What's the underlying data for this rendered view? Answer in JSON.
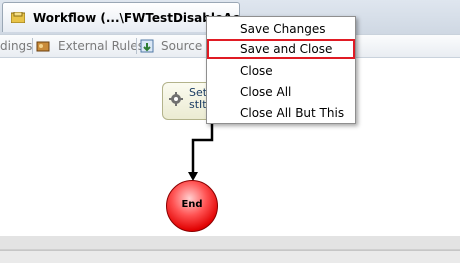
{
  "tab": {
    "title": "Workflow (...\\FWTestDisableAcco"
  },
  "toolbar": {
    "items": [
      {
        "label": "dings"
      },
      {
        "label": "External Rules"
      },
      {
        "label": "Source C"
      }
    ]
  },
  "activity": {
    "line1": "SetE",
    "line2": "stIte"
  },
  "end_node": {
    "label": "End"
  },
  "context_menu": {
    "items": [
      {
        "label": "Save Changes"
      },
      {
        "label": "Save and Close",
        "highlighted": true
      },
      {
        "label": "Close"
      },
      {
        "label": "Close All"
      },
      {
        "label": "Close All But This"
      }
    ]
  },
  "colors": {
    "highlight_border": "#e01b24",
    "end_node": "#e00000"
  }
}
